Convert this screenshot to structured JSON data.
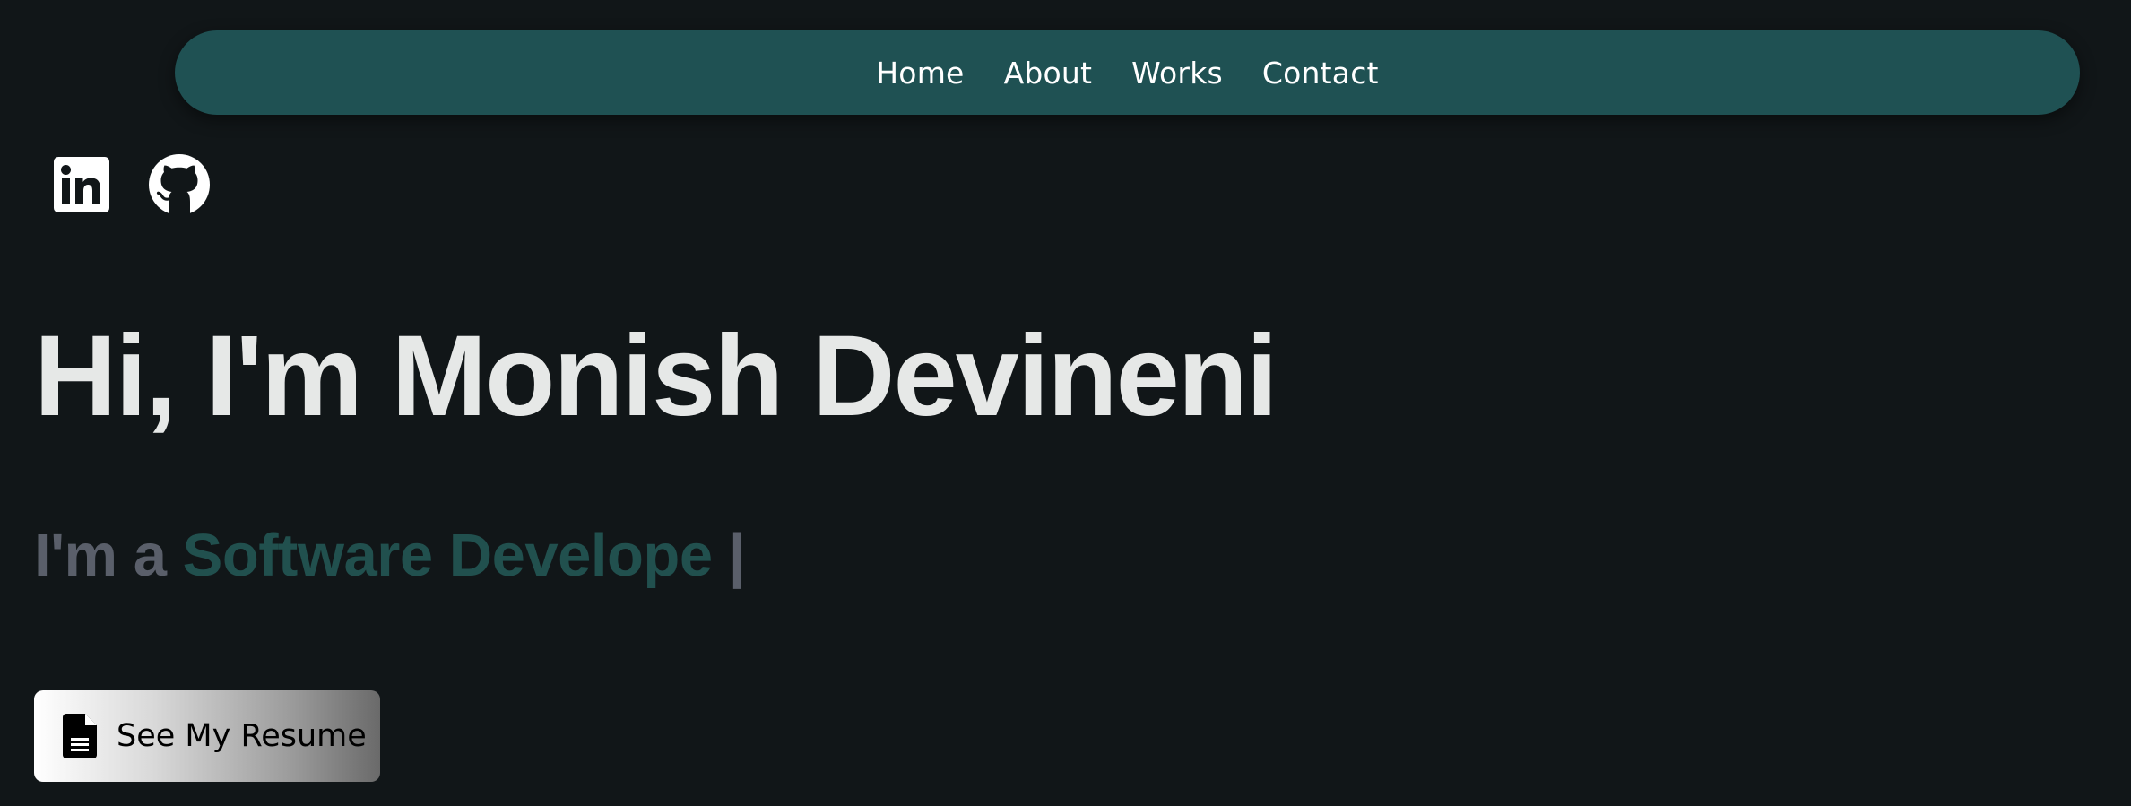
{
  "nav": {
    "items": [
      {
        "label": "Home"
      },
      {
        "label": "About"
      },
      {
        "label": "Works"
      },
      {
        "label": "Contact"
      }
    ]
  },
  "socials": {
    "icons": [
      "linkedin-icon",
      "github-icon"
    ]
  },
  "hero": {
    "title": "Hi, I'm Monish Devineni",
    "subtitle_prefix": "I'm a ",
    "subtitle_role": "Software Develope",
    "subtitle_cursor": " |"
  },
  "resume": {
    "label": "See My Resume",
    "icon": "document-icon"
  },
  "colors": {
    "background": "#111618",
    "nav_background": "#1f5153",
    "title": "#e6e8e7",
    "subtitle_prefix": "#5a5f6a",
    "subtitle_role": "#21504e"
  }
}
